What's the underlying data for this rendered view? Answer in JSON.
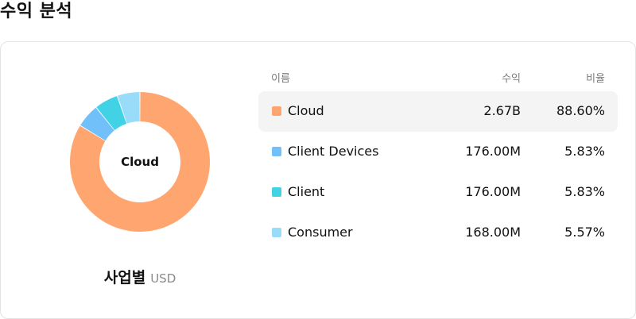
{
  "page": {
    "title": "수익 분석"
  },
  "donut": {
    "center_label": "Cloud",
    "caption_title": "사업별",
    "caption_currency": "USD"
  },
  "table": {
    "headers": {
      "name": "이름",
      "revenue": "수익",
      "ratio": "비율"
    },
    "rows": [
      {
        "name": "Cloud",
        "revenue": "2.67B",
        "ratio": "88.60%",
        "color": "#FFA670",
        "selected": true
      },
      {
        "name": "Client Devices",
        "revenue": "176.00M",
        "ratio": "5.83%",
        "color": "#72C0FA",
        "selected": false
      },
      {
        "name": "Client",
        "revenue": "176.00M",
        "ratio": "5.83%",
        "color": "#42D2E6",
        "selected": false
      },
      {
        "name": "Consumer",
        "revenue": "168.00M",
        "ratio": "5.57%",
        "color": "#98DCFA",
        "selected": false
      }
    ]
  },
  "chart_data": {
    "type": "pie",
    "categories": [
      "Cloud",
      "Client Devices",
      "Client",
      "Consumer"
    ],
    "values": [
      88.6,
      5.83,
      5.83,
      5.57
    ],
    "colors": [
      "#FFA670",
      "#72C0FA",
      "#42D2E6",
      "#98DCFA"
    ],
    "title": ""
  }
}
